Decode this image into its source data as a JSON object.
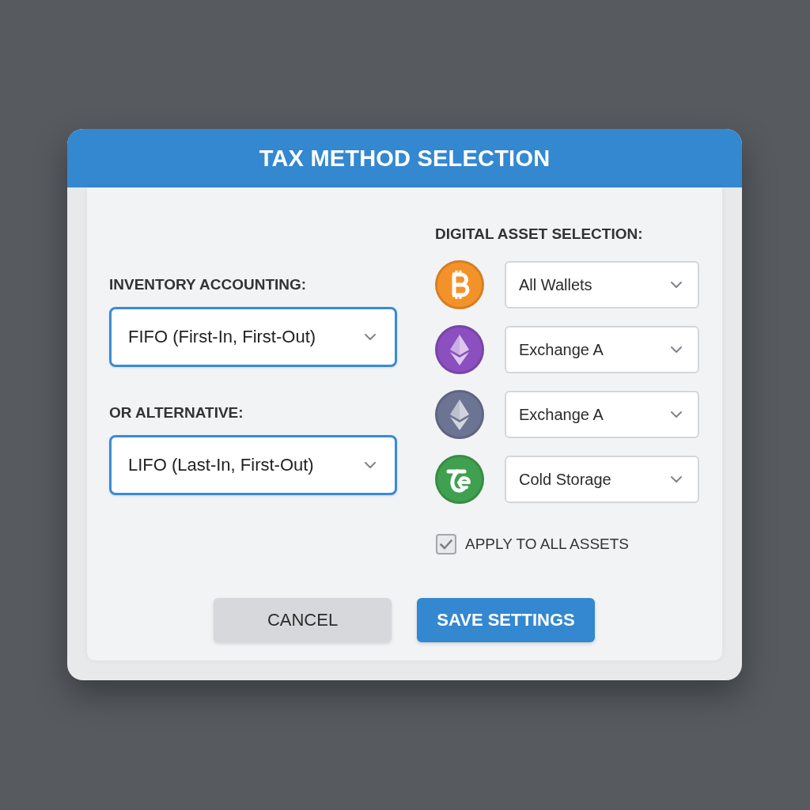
{
  "dialog": {
    "title": "TAX METHOD SELECTION"
  },
  "methods": [
    {
      "label": "INVENTORY ACCOUNTING:",
      "value": "FIFO (First-In, First-Out)"
    },
    {
      "label": "OR ALTERNATIVE:",
      "value": "LIFO (Last-In, First-Out)"
    }
  ],
  "assets": {
    "heading": "DIGITAL ASSET SELECTION:",
    "items": [
      {
        "kind": "bitcoin",
        "color": "#f4922a",
        "value": "All Wallets"
      },
      {
        "kind": "ether",
        "color": "#8b4fc0",
        "value": "Exchange A"
      },
      {
        "kind": "ether",
        "color": "#6c7494",
        "value": "Exchange A"
      },
      {
        "kind": "swirl",
        "color": "#3fa14f",
        "value": "Cold Storage"
      }
    ]
  },
  "apply_all": {
    "label": "APPLY TO ALL ASSETS",
    "checked": true
  },
  "buttons": [
    {
      "label": "CANCEL",
      "kind": "secondary"
    },
    {
      "label": "SAVE SETTINGS",
      "kind": "primary"
    }
  ]
}
